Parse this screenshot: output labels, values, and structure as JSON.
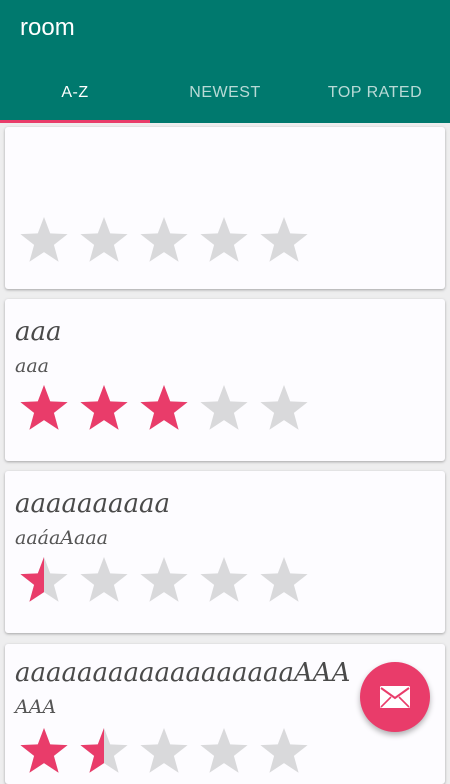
{
  "app": {
    "title": "room"
  },
  "tabs": [
    {
      "label": "A-Z",
      "active": true
    },
    {
      "label": "NEWEST",
      "active": false
    },
    {
      "label": "TOP RATED",
      "active": false
    }
  ],
  "items": [
    {
      "title": "",
      "subtitle": "",
      "rating": 0
    },
    {
      "title": "aaa",
      "subtitle": "aaa",
      "rating": 3
    },
    {
      "title": "aaaaaaaaaa",
      "subtitle": "aaáaAaaa",
      "rating": 0.5
    },
    {
      "title": "aaaaaaaaaaaaaaaaaaAAA",
      "subtitle": "AAA",
      "rating": 1.5
    }
  ],
  "fab": {
    "icon": "mail-icon"
  },
  "colors": {
    "primary": "#00796e",
    "accent": "#e93c6a",
    "star_empty": "#d9d9db"
  }
}
